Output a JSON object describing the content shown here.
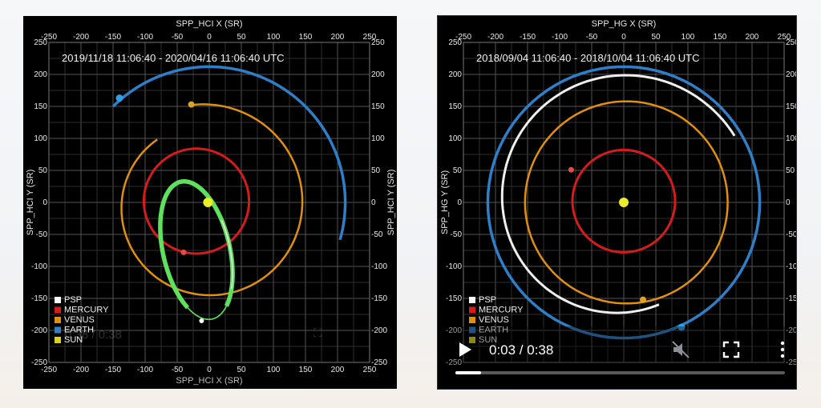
{
  "plot_left": {
    "x_axis_title": "SPP_HCI X (SR)",
    "y_axis_title": "SPP_HCI Y (SR)",
    "date_range": "2019/11/18 11:06:40 - 2020/04/16 11:06:40 UTC",
    "legend": [
      "PSP",
      "MERCURY",
      "VENUS",
      "EARTH",
      "SUN"
    ],
    "ghost_time": "0:38 / 0:38"
  },
  "plot_right": {
    "x_axis_title": "SPP_HG X (SR)",
    "y_axis_title": "SPP_HG Y (SR)",
    "date_range": "2018/09/04 11:06:40 - 2018/10/04 11:06:40 UTC",
    "legend": [
      "PSP",
      "MERCURY",
      "VENUS",
      "EARTH",
      "SUN"
    ]
  },
  "axis_ticks": [
    "-250",
    "-200",
    "-150",
    "-100",
    "-50",
    "0",
    "50",
    "100",
    "150",
    "200",
    "250"
  ],
  "legend_colors": [
    "#ffffff",
    "#d51c1c",
    "#e08f10",
    "#2f7fc8",
    "#d8d21c"
  ],
  "video": {
    "time_display": "0:03 / 0:38",
    "progress_fraction": 0.079
  }
}
